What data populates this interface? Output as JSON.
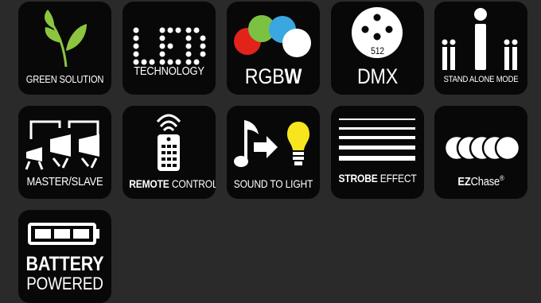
{
  "icons": [
    {
      "label": "GREEN SOLUTION"
    },
    {
      "label": "TECHNOLOGY",
      "logo_text": "LED"
    },
    {
      "label_main": "RGB",
      "label_bold": "W",
      "colors": [
        "#e2231a",
        "#7cc242",
        "#3aa7e0",
        "#ffffff"
      ]
    },
    {
      "label": "DMX",
      "connector_text": "512"
    },
    {
      "label": "STAND ALONE MODE"
    },
    {
      "label": "MASTER/SLAVE"
    },
    {
      "label_bold": "REMOTE",
      "label_rest": "CONTROL"
    },
    {
      "label": "SOUND TO LIGHT",
      "bulb_color": "#f7e51e"
    },
    {
      "label_bold": "STROBE",
      "label_rest": "EFFECT"
    },
    {
      "label_bold": "EZ",
      "label_rest": "Chase",
      "label_sup": "®"
    },
    {
      "label_line1": "BATTERY",
      "label_line2": "POWERED"
    }
  ],
  "colors": {
    "background": "#2a2a2a",
    "tile": "#080808",
    "leaf_green": "#8cc63f"
  }
}
